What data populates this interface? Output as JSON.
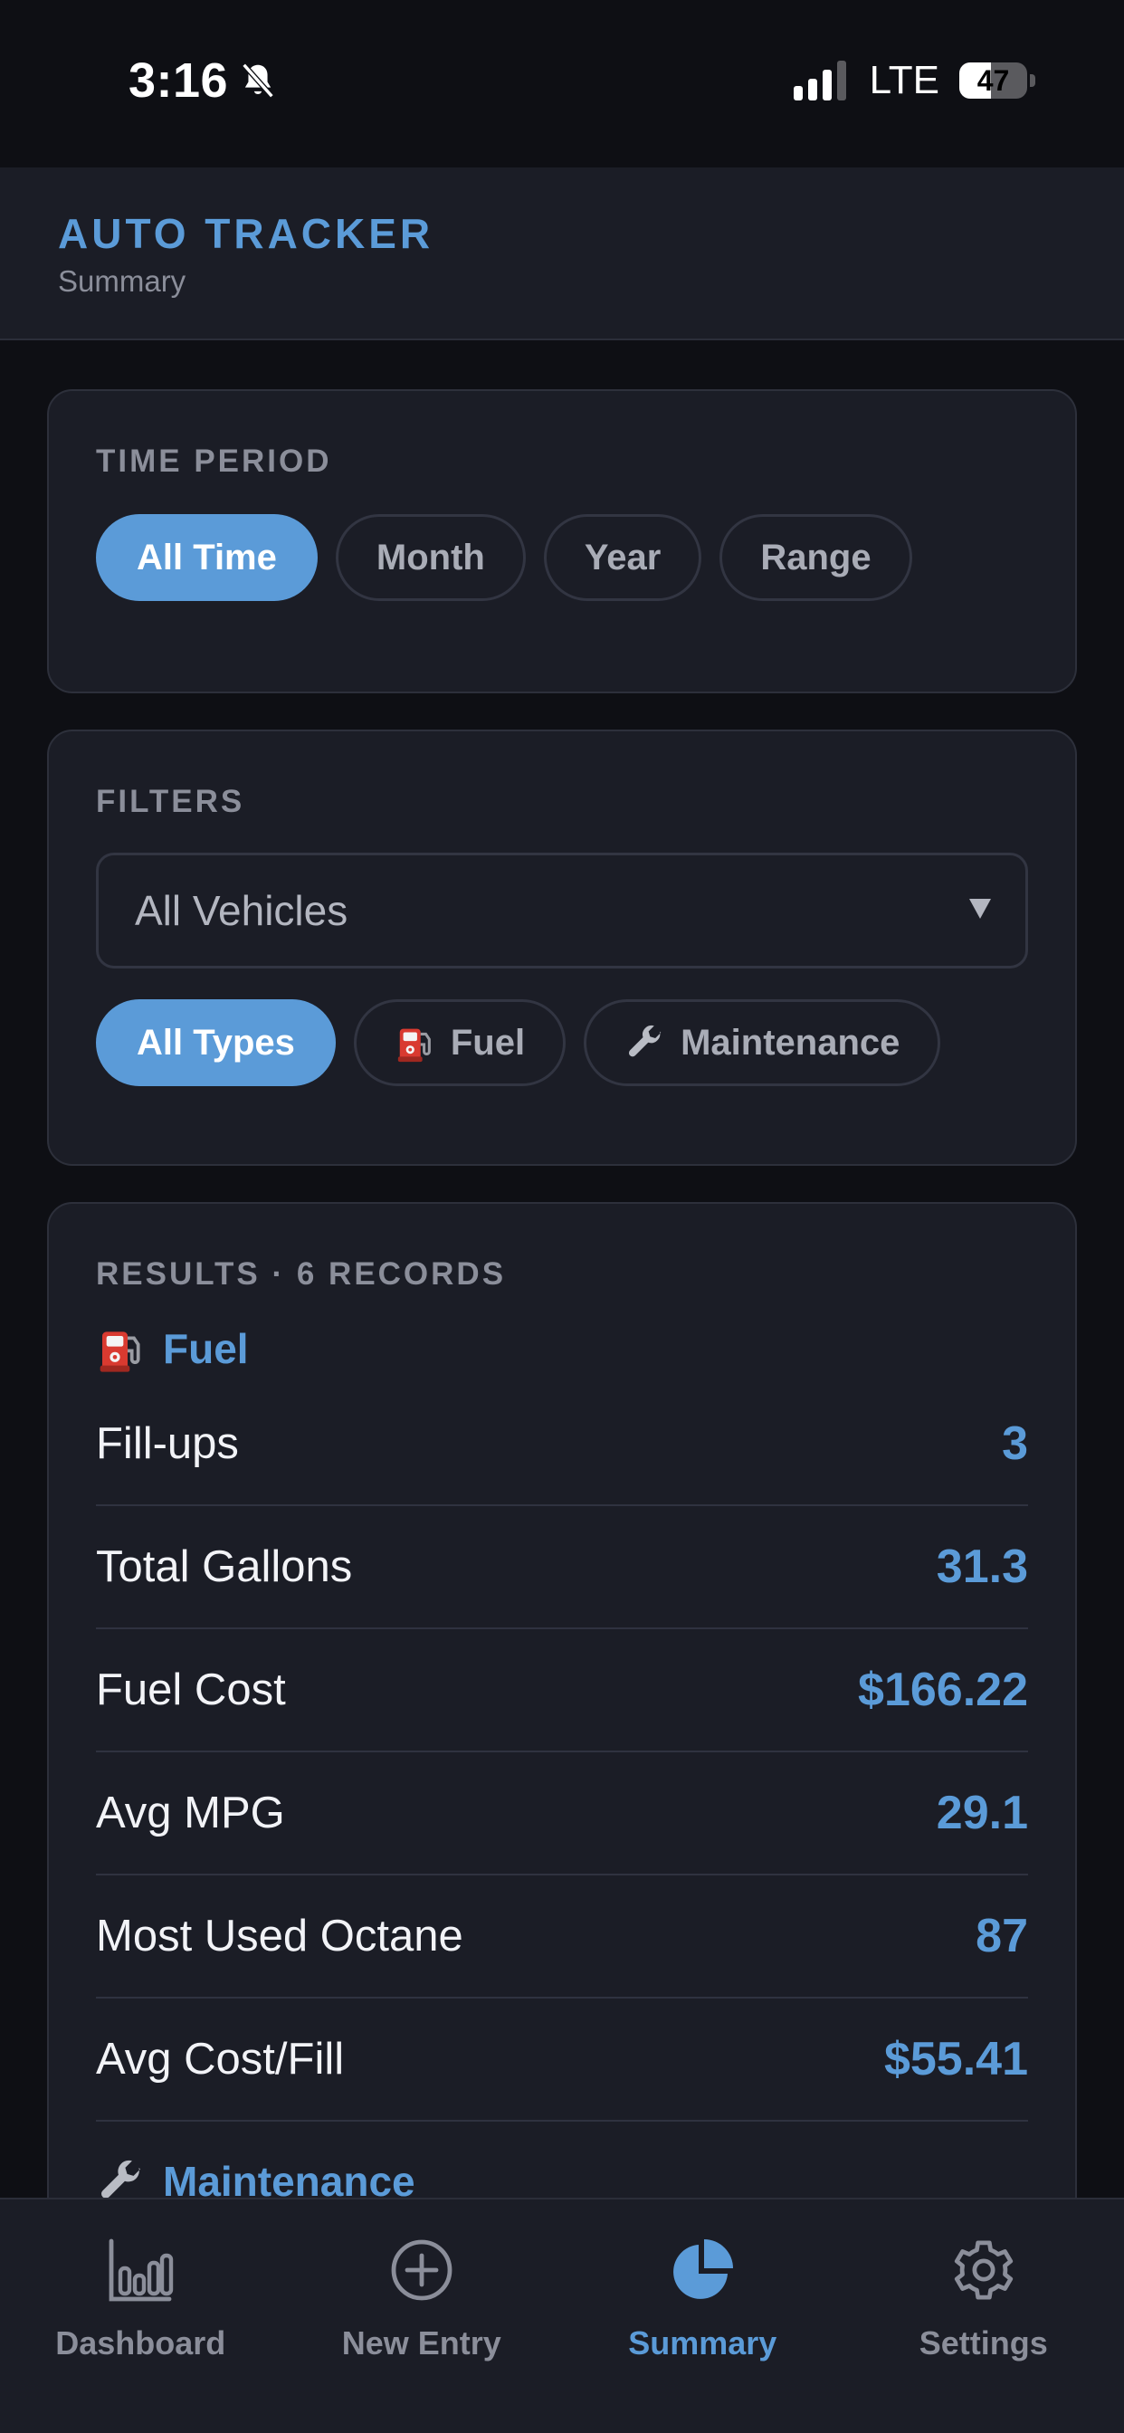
{
  "status_bar": {
    "time": "3:16",
    "network": "LTE",
    "battery": "47",
    "battery_level": 0.47
  },
  "header": {
    "title": "AUTO TRACKER",
    "subtitle": "Summary"
  },
  "time_period": {
    "label": "TIME PERIOD",
    "options": [
      "All Time",
      "Month",
      "Year",
      "Range"
    ],
    "selected": "All Time"
  },
  "filters": {
    "label": "FILTERS",
    "vehicle_select": {
      "value": "All Vehicles"
    },
    "types": [
      "All Types",
      "Fuel",
      "Maintenance"
    ],
    "selected_type": "All Types"
  },
  "results": {
    "label": "RESULTS · 6 RECORDS",
    "fuel": {
      "title": "Fuel",
      "stats": [
        {
          "label": "Fill-ups",
          "value": "3"
        },
        {
          "label": "Total Gallons",
          "value": "31.3"
        },
        {
          "label": "Fuel Cost",
          "value": "$166.22"
        },
        {
          "label": "Avg MPG",
          "value": "29.1"
        },
        {
          "label": "Most Used Octane",
          "value": "87"
        },
        {
          "label": "Avg Cost/Fill",
          "value": "$55.41"
        }
      ]
    },
    "maintenance": {
      "title": "Maintenance"
    }
  },
  "nav": {
    "items": [
      {
        "label": "Dashboard",
        "icon": "bar-chart-icon"
      },
      {
        "label": "New Entry",
        "icon": "plus-circle-icon"
      },
      {
        "label": "Summary",
        "icon": "pie-chart-icon"
      },
      {
        "label": "Settings",
        "icon": "gear-icon"
      }
    ],
    "active": "Summary"
  },
  "colors": {
    "accent": "#5b9bd8",
    "background": "#0e0f14",
    "card": "#1b1d26"
  }
}
